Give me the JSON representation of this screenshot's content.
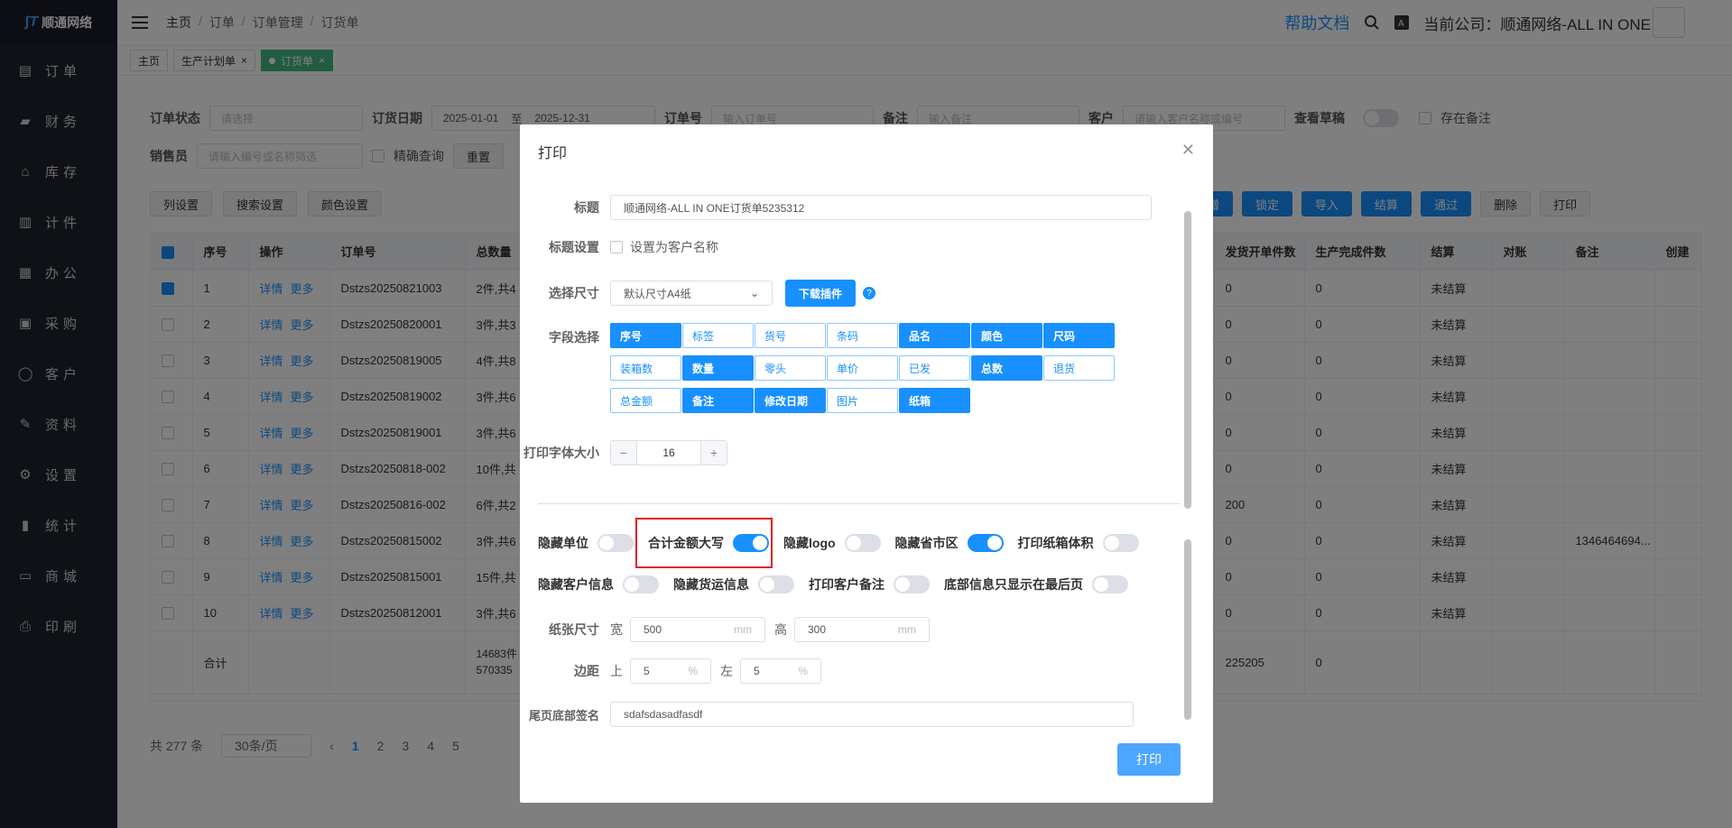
{
  "app": {
    "brand": "顺通网络",
    "help": "帮助文档",
    "company_label": "当前公司：",
    "company_name": "顺通网络-ALL IN ONE"
  },
  "breadcrumbs": [
    "主页",
    "订单",
    "订单管理",
    "订货单"
  ],
  "sidebar": {
    "items": [
      {
        "label": "订单",
        "icon": "document-icon"
      },
      {
        "label": "财务",
        "icon": "wallet-icon"
      },
      {
        "label": "库存",
        "icon": "home-icon"
      },
      {
        "label": "计件",
        "icon": "clipboard-icon"
      },
      {
        "label": "办公",
        "icon": "calendar-icon"
      },
      {
        "label": "采购",
        "icon": "bag-icon"
      },
      {
        "label": "客户",
        "icon": "user-icon"
      },
      {
        "label": "资料",
        "icon": "pen-icon"
      },
      {
        "label": "设置",
        "icon": "gear-icon"
      },
      {
        "label": "统计",
        "icon": "bar-chart-icon"
      },
      {
        "label": "商城",
        "icon": "monitor-icon"
      },
      {
        "label": "印刷",
        "icon": "printer-icon"
      }
    ]
  },
  "tabs": [
    {
      "label": "主页"
    },
    {
      "label": "生产计划单"
    },
    {
      "label": "订货单"
    }
  ],
  "filters": {
    "status_label": "订单状态",
    "status_placeholder": "请选择",
    "date_label": "订货日期",
    "date_from": "2025-01-01",
    "date_sep": "至",
    "date_to": "2025-12-31",
    "order_label": "订单号",
    "order_placeholder": "输入订单号",
    "remark_label": "备注",
    "remark_placeholder": "输入备注",
    "customer_label": "客户",
    "customer_placeholder": "请输入客户名称或编号",
    "draft_label": "查看草稿",
    "has_remark_label": "存在备注",
    "sales_label": "销售员",
    "sales_placeholder": "请输入编号或名称筛选",
    "exact_label": "精确查询",
    "reset_label": "重置"
  },
  "toolbar": {
    "left": [
      "列设置",
      "搜索设置",
      "颜色设置"
    ],
    "right": [
      "新增",
      "锁定",
      "导入",
      "结算",
      "通过",
      "删除",
      "打印"
    ]
  },
  "table": {
    "headers": [
      "序号",
      "操作",
      "订单号",
      "总数量",
      "发货开单件数",
      "生产完成件数",
      "结算",
      "对账",
      "备注",
      "创建"
    ],
    "detail_label": "详情",
    "more_label": "更多",
    "rows": [
      {
        "no": "1",
        "order": "Dstzs20250821003",
        "qty": "2件,共4",
        "ship": "0",
        "done": "0",
        "settle": "未结算",
        "remark": "",
        "checked": true
      },
      {
        "no": "2",
        "order": "Dstzs20250820001",
        "qty": "3件,共3",
        "ship": "0",
        "done": "0",
        "settle": "未结算",
        "remark": "",
        "checked": false
      },
      {
        "no": "3",
        "order": "Dstzs20250819005",
        "qty": "4件,共8",
        "ship": "0",
        "done": "0",
        "settle": "未结算",
        "remark": "",
        "checked": false
      },
      {
        "no": "4",
        "order": "Dstzs20250819002",
        "qty": "3件,共6",
        "ship": "0",
        "done": "0",
        "settle": "未结算",
        "remark": "",
        "checked": false
      },
      {
        "no": "5",
        "order": "Dstzs20250819001",
        "qty": "3件,共6",
        "ship": "0",
        "done": "0",
        "settle": "未结算",
        "remark": "",
        "checked": false
      },
      {
        "no": "6",
        "order": "Dstzs20250818-002",
        "qty": "10件,共",
        "ship": "0",
        "done": "0",
        "settle": "未结算",
        "remark": "",
        "checked": false
      },
      {
        "no": "7",
        "order": "Dstzs20250816-002",
        "qty": "6件,共2",
        "ship": "200",
        "done": "0",
        "settle": "未结算",
        "remark": "",
        "checked": false
      },
      {
        "no": "8",
        "order": "Dstzs20250815002",
        "qty": "3件,共6",
        "ship": "0",
        "done": "0",
        "settle": "未结算",
        "remark": "1346464694...",
        "checked": false
      },
      {
        "no": "9",
        "order": "Dstzs20250815001",
        "qty": "15件,共",
        "ship": "0",
        "done": "0",
        "settle": "未结算",
        "remark": "",
        "checked": false
      },
      {
        "no": "10",
        "order": "Dstzs20250812001",
        "qty": "3件,共6",
        "ship": "0",
        "done": "0",
        "settle": "未结算",
        "remark": "",
        "checked": false
      }
    ],
    "total_label": "合计",
    "total_qty_1": "14683件",
    "total_qty_2": "570335",
    "total_ship": "225205",
    "total_done": "0"
  },
  "pager": {
    "total": "共 277 条",
    "size": "30条/页",
    "pages": [
      "1",
      "2",
      "3",
      "4",
      "5"
    ]
  },
  "modal": {
    "title": "打印",
    "title_label": "标题",
    "title_value": "顺通网络-ALL IN ONE订货单5235312",
    "title_setting_label": "标题设置",
    "title_setting_option": "设置为客户名称",
    "size_label": "选择尺寸",
    "size_value": "默认尺寸A4纸",
    "download_label": "下载插件",
    "fields_label": "字段选择",
    "fields": [
      {
        "label": "序号",
        "on": true
      },
      {
        "label": "标签",
        "on": false
      },
      {
        "label": "货号",
        "on": false
      },
      {
        "label": "条码",
        "on": false
      },
      {
        "label": "品名",
        "on": true
      },
      {
        "label": "颜色",
        "on": true
      },
      {
        "label": "尺码",
        "on": true
      },
      {
        "label": "装箱数",
        "on": false
      },
      {
        "label": "数量",
        "on": true
      },
      {
        "label": "零头",
        "on": false
      },
      {
        "label": "单价",
        "on": false
      },
      {
        "label": "已发",
        "on": false
      },
      {
        "label": "总数",
        "on": true
      },
      {
        "label": "退货",
        "on": false
      },
      {
        "label": "总金额",
        "on": false
      },
      {
        "label": "备注",
        "on": true
      },
      {
        "label": "修改日期",
        "on": true
      },
      {
        "label": "图片",
        "on": false
      },
      {
        "label": "纸箱",
        "on": true
      }
    ],
    "font_size_label": "打印字体大小",
    "font_size_value": "16",
    "switches_row1": [
      {
        "label": "隐藏单位",
        "on": false
      },
      {
        "label": "合计金额大写",
        "on": true
      },
      {
        "label": "隐藏logo",
        "on": false
      },
      {
        "label": "隐藏省市区",
        "on": true
      },
      {
        "label": "打印纸箱体积",
        "on": false
      }
    ],
    "switches_row2": [
      {
        "label": "隐藏客户信息",
        "on": false
      },
      {
        "label": "隐藏货运信息",
        "on": false
      },
      {
        "label": "打印客户备注",
        "on": false
      },
      {
        "label": "底部信息只显示在最后页",
        "on": false
      }
    ],
    "paper_label": "纸张尺寸",
    "width_label": "宽",
    "width_value": "500",
    "height_label": "高",
    "height_value": "300",
    "unit_mm": "mm",
    "margin_label": "边距",
    "top_label": "上",
    "top_value": "5",
    "left_label": "左",
    "left_value": "5",
    "unit_pct": "%",
    "footer_label": "尾页底部签名",
    "footer_value": "sdafsdasadfasdf",
    "print_label": "打印"
  }
}
